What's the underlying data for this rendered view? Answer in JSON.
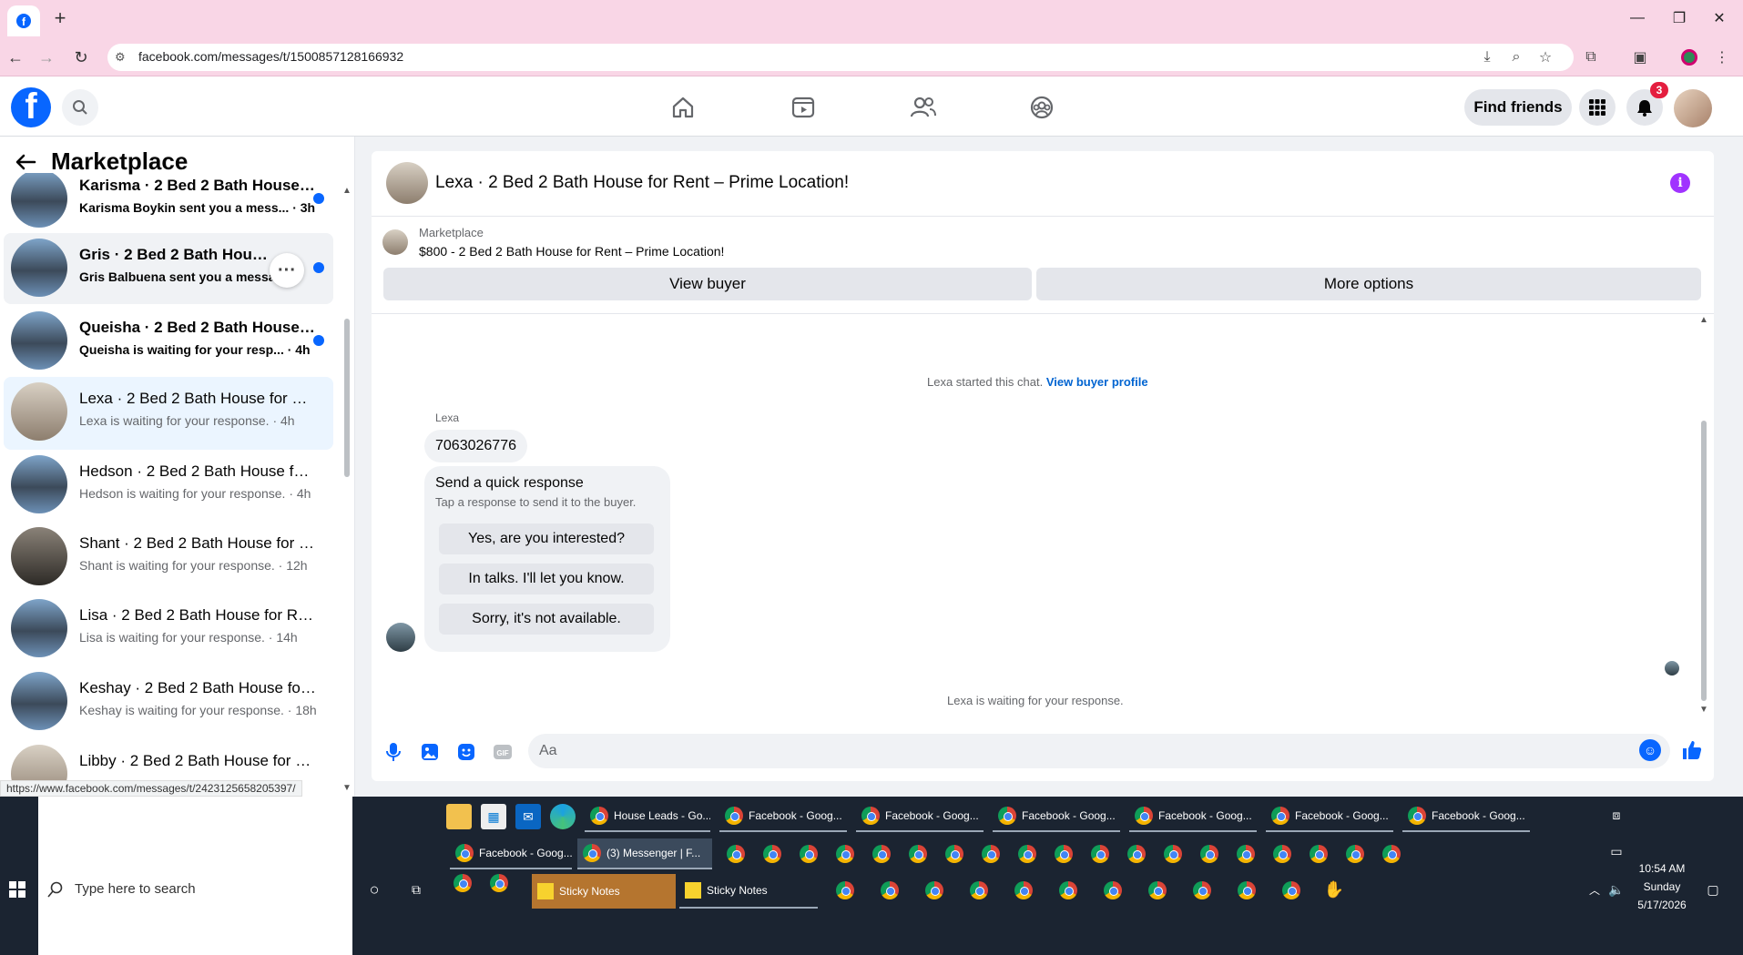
{
  "browser": {
    "url": "facebook.com/messages/t/1500857128166932",
    "status_url": "https://www.facebook.com/messages/t/2423125658205397/"
  },
  "header": {
    "find_friends": "Find friends",
    "notification_count": "3"
  },
  "sidebar": {
    "title": "Marketplace",
    "conversations": [
      {
        "title": "Karisma · 2 Bed 2 Bath House f...",
        "sub": "Karisma Boykin sent you a mess... · 3h",
        "unread": true
      },
      {
        "title": "Gris · 2 Bed 2 Bath House for",
        "sub": "Gris Balbuena sent you a messa...",
        "unread": true
      },
      {
        "title": "Queisha · 2 Bed 2 Bath House f...",
        "sub": "Queisha is waiting for your resp... · 4h",
        "unread": true
      },
      {
        "title": "Lexa · 2 Bed 2 Bath House for Re...",
        "sub": "Lexa is waiting for your response. · 4h",
        "unread": false
      },
      {
        "title": "Hedson · 2 Bed 2 Bath House for...",
        "sub": "Hedson is waiting for your response. · 4h",
        "unread": false
      },
      {
        "title": "Shant · 2 Bed 2 Bath House for R...",
        "sub": "Shant is waiting for your response. · 12h",
        "unread": false
      },
      {
        "title": "Lisa · 2 Bed 2 Bath House for Re...",
        "sub": "Lisa is waiting for your response. · 14h",
        "unread": false
      },
      {
        "title": "Keshay · 2 Bed 2 Bath House for ...",
        "sub": "Keshay is waiting for your response. · 18h",
        "unread": false
      },
      {
        "title": "Libby · 2 Bed 2 Bath House for R...",
        "sub": "",
        "unread": false
      }
    ]
  },
  "chat": {
    "title": "Lexa · 2 Bed 2 Bath House for Rent – Prime Location!",
    "marketplace_label": "Marketplace",
    "listing": "$800 - 2 Bed 2 Bath House for Rent – Prime Location!",
    "view_buyer": "View buyer",
    "more_options": "More options",
    "started_text": "Lexa started this chat.",
    "view_profile": "View buyer profile",
    "sender_name": "Lexa",
    "phone_message": "7063026776",
    "quick_response_title": "Send a quick response",
    "quick_response_sub": "Tap a response to send it to the buyer.",
    "quick_responses": [
      "Yes, are you interested?",
      "In talks. I'll let you know.",
      "Sorry, it's not available."
    ],
    "waiting_text": "Lexa is waiting for your response.",
    "composer_placeholder": "Aa"
  },
  "taskbar": {
    "search_placeholder": "Type here to search",
    "row1": [
      "House Leads - Go...",
      "Facebook - Goog...",
      "Facebook - Goog...",
      "Facebook - Goog...",
      "Facebook - Goog...",
      "Facebook - Goog...",
      "Facebook - Goog..."
    ],
    "row2": [
      "Facebook - Goog...",
      "(3) Messenger | F..."
    ],
    "row3": [
      "Sticky Notes",
      "Sticky Notes"
    ],
    "time": "10:54 AM",
    "day": "Sunday",
    "date": "5/17/2026"
  },
  "colors": {
    "fb_blue": "#0866ff",
    "tab_bar": "#f9d6e6",
    "taskbar": "#1b2431",
    "badge_red": "#e41e3f",
    "info_purple": "#a033ff"
  },
  "icons": [
    "facebook-logo",
    "search-icon",
    "home-icon",
    "video-icon",
    "friends-icon",
    "groups-icon",
    "menu-grid-icon",
    "bell-icon",
    "back-arrow-icon",
    "info-icon",
    "microphone-icon",
    "image-icon",
    "sticker-icon",
    "gif-icon",
    "emoji-icon",
    "like-icon"
  ]
}
